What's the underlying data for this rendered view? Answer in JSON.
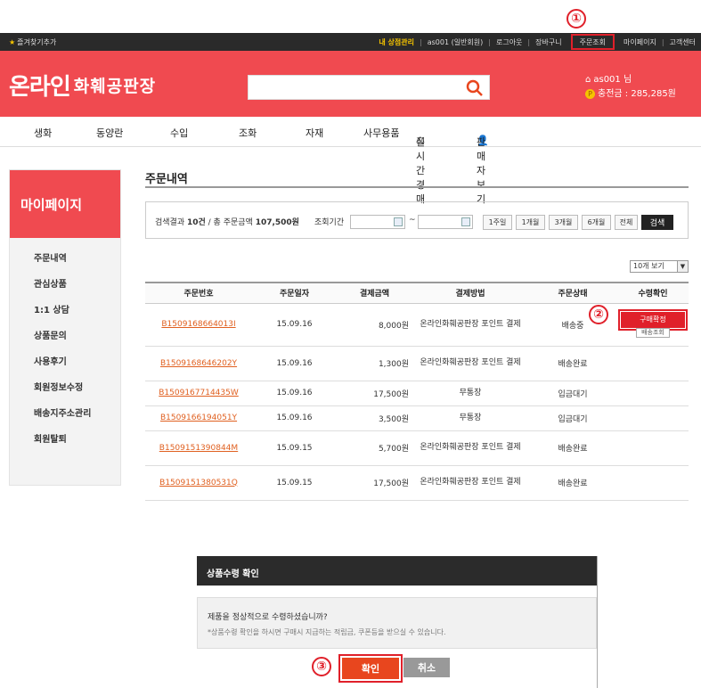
{
  "topbar": {
    "favorite": "즐겨찾기추가",
    "shop_admin": "내 상점관리",
    "user_type": "as001 (일반회원)",
    "logout": "로그아웃",
    "cart": "장바구니",
    "order_lookup": "주문조회",
    "mypage": "마이페이지",
    "support": "고객센터"
  },
  "callouts": {
    "one": "①",
    "two": "②",
    "three": "③"
  },
  "header": {
    "logo_main": "온라인",
    "logo_sub": "화훼공판장",
    "search_placeholder": "",
    "user_name": "as001 님",
    "points": "충전금 : 285,285원"
  },
  "nav": [
    "생화",
    "동양란",
    "수입",
    "조화",
    "자재",
    "사무용품",
    "실시간경매",
    "판매자보기"
  ],
  "sidebar": {
    "title": "마이페이지",
    "items": [
      "주문내역",
      "관심상품",
      "1:1 상담",
      "상품문의",
      "사용후기",
      "회원정보수정",
      "배송지주소관리",
      "회원탈퇴"
    ]
  },
  "main": {
    "title": "주문내역",
    "result_prefix": "검색결과 ",
    "result_count": "10건",
    "result_mid": " / 총 주문금액 ",
    "result_total": "107,500원",
    "period_label": "조회기간",
    "tilde": "~",
    "buttons": [
      "1주일",
      "1개월",
      "3개월",
      "6개월",
      "전체"
    ],
    "search_button": "검색",
    "per_page": "10개 보기"
  },
  "table": {
    "headers": [
      "주문번호",
      "주문일자",
      "결제금액",
      "결제방법",
      "주문상태",
      "수령확인"
    ],
    "rows": [
      {
        "no": "B1509168664013I",
        "date": "15.09.16",
        "amount": "8,000원",
        "method": "온라인화훼공판장 포인트 결제",
        "status": "배송중"
      },
      {
        "no": "B1509168646202Y",
        "date": "15.09.16",
        "amount": "1,300원",
        "method": "온라인화훼공판장 포인트 결제",
        "status": "배송완료"
      },
      {
        "no": "B1509167714435W",
        "date": "15.09.16",
        "amount": "17,500원",
        "method": "무통장",
        "status": "입금대기"
      },
      {
        "no": "B1509166194051Y",
        "date": "15.09.16",
        "amount": "3,500원",
        "method": "무통장",
        "status": "입금대기"
      },
      {
        "no": "B1509151390844M",
        "date": "15.09.15",
        "amount": "5,700원",
        "method": "온라인화훼공판장 포인트 결제",
        "status": "배송완료"
      },
      {
        "no": "B1509151380531Q",
        "date": "15.09.15",
        "amount": "17,500원",
        "method": "온라인화훼공판장 포인트 결제",
        "status": "배송완료"
      }
    ],
    "confirm_label": "구매확정",
    "view_label": "배송조회"
  },
  "dialog": {
    "title": "상품수령 확인",
    "question": "제품을 정상적으로 수령하셨습니까?",
    "note": "*상품수령 확인을 하시면 구매시 지급하는 적립금, 쿠폰등을 받으실 수 있습니다.",
    "ok": "확인",
    "cancel": "취소"
  },
  "colors": {
    "brand": "#f04a50",
    "callout": "#e0202a",
    "order_link": "#e06020"
  }
}
